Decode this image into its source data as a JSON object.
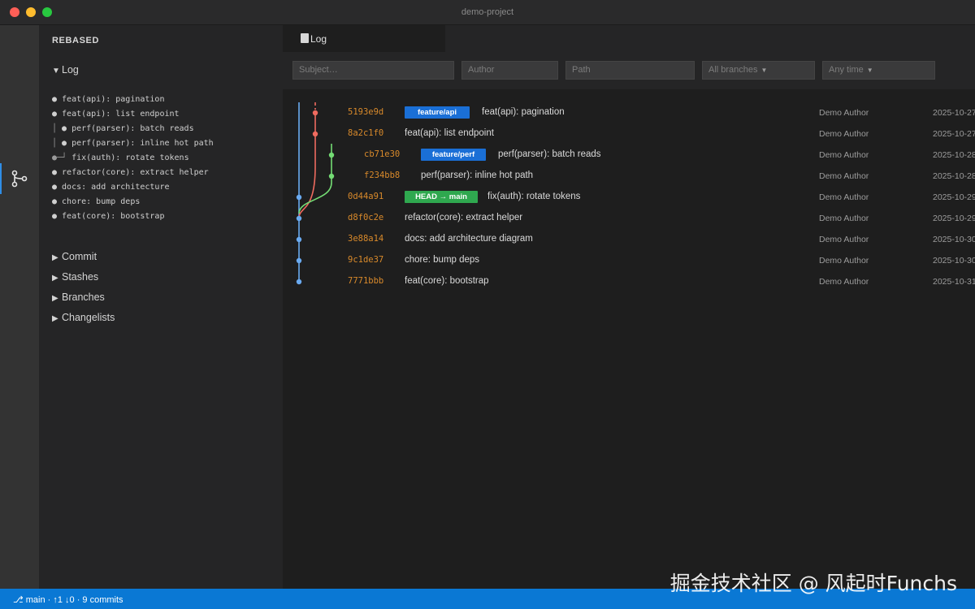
{
  "window": {
    "title": "demo-project"
  },
  "activity_bar": {
    "active_icon": "source-control-graph-icon"
  },
  "sidebar": {
    "heading": "REBASED",
    "log_section": {
      "label": "Log",
      "expanded": true
    },
    "log_tree": [
      {
        "gutter": "",
        "text": "● feat(api): pagination"
      },
      {
        "gutter": "",
        "text": "● feat(api): list endpoint"
      },
      {
        "gutter": "│ ",
        "text": "● perf(parser): batch reads"
      },
      {
        "gutter": "│ ",
        "text": "● perf(parser): inline hot path"
      },
      {
        "gutter": "●─┘ ",
        "text": "fix(auth): rotate tokens"
      },
      {
        "gutter": "",
        "text": "● refactor(core): extract helper"
      },
      {
        "gutter": "",
        "text": "● docs: add architecture"
      },
      {
        "gutter": "",
        "text": "● chore: bump deps"
      },
      {
        "gutter": "",
        "text": "● feat(core): bootstrap"
      }
    ],
    "sections": [
      {
        "label": "Commit",
        "expanded": false
      },
      {
        "label": "Stashes",
        "expanded": false
      },
      {
        "label": "Branches",
        "expanded": false
      },
      {
        "label": "Changelists",
        "expanded": false
      }
    ]
  },
  "editor": {
    "tab": {
      "label": "Log"
    },
    "filters": {
      "subject_placeholder": "Subject…",
      "author_placeholder": "Author",
      "path_placeholder": "Path",
      "branch_select": "All branches",
      "time_select": "Any time"
    },
    "commits": [
      {
        "hash": "5193e9d",
        "badge": "feature/api",
        "subject": "feat(api): pagination",
        "author": "Demo Author",
        "date": "2025-10-27",
        "lane": "red",
        "indent": 0
      },
      {
        "hash": "8a2c1f0",
        "badge": "",
        "subject": "feat(api): list endpoint",
        "author": "Demo Author",
        "date": "2025-10-27",
        "lane": "red",
        "indent": 0
      },
      {
        "hash": "cb71e30",
        "badge": "feature/perf",
        "subject": "perf(parser): batch reads",
        "author": "Demo Author",
        "date": "2025-10-28",
        "lane": "green",
        "indent": 1
      },
      {
        "hash": "f234bb8",
        "badge": "",
        "subject": "perf(parser): inline hot path",
        "author": "Demo Author",
        "date": "2025-10-28",
        "lane": "green",
        "indent": 1
      },
      {
        "hash": "0d44a91",
        "badge": "HEAD → main",
        "subject": "fix(auth): rotate tokens",
        "author": "Demo Author",
        "date": "2025-10-29",
        "lane": "blue",
        "indent": 0
      },
      {
        "hash": "d8f0c2e",
        "badge": "",
        "subject": "refactor(core): extract helper",
        "author": "Demo Author",
        "date": "2025-10-29",
        "lane": "blue",
        "indent": 0
      },
      {
        "hash": "3e88a14",
        "badge": "",
        "subject": "docs: add architecture diagram",
        "author": "Demo Author",
        "date": "2025-10-30",
        "lane": "blue",
        "indent": 0
      },
      {
        "hash": "9c1de37",
        "badge": "",
        "subject": "chore: bump deps",
        "author": "Demo Author",
        "date": "2025-10-30",
        "lane": "blue",
        "indent": 0
      },
      {
        "hash": "7771bbb",
        "badge": "",
        "subject": "feat(core): bootstrap",
        "author": "Demo Author",
        "date": "2025-10-31",
        "lane": "blue",
        "indent": 0
      }
    ],
    "lane_colors": {
      "blue": "#6aaaf0",
      "red": "#ef6b5f",
      "green": "#74dc74"
    },
    "badge_colors": {
      "branch": "#1a6fd6",
      "head": "#2fa84f"
    }
  },
  "statusbar": {
    "text": "⎇ main · ↑1 ↓0 · 9 commits",
    "color": "#0a78d4"
  },
  "watermark": {
    "text": "掘金技术社区 @ 风起时Funchs"
  }
}
